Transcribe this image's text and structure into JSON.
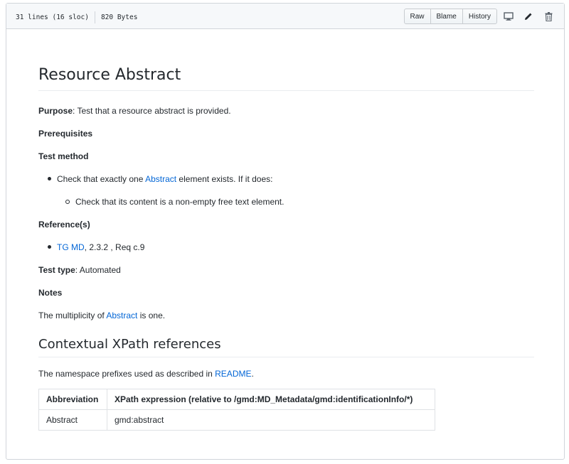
{
  "file_header": {
    "lines": "31 lines (16 sloc)",
    "size": "820 Bytes",
    "buttons": {
      "raw": "Raw",
      "blame": "Blame",
      "history": "History"
    },
    "icons": [
      "desktop-icon",
      "pencil-icon",
      "trash-icon"
    ]
  },
  "content": {
    "title": "Resource Abstract",
    "purpose_label": "Purpose",
    "purpose_text": ": Test that a resource abstract is provided.",
    "prerequisites_label": "Prerequisites",
    "test_method_label": "Test method",
    "bullet1_pre": "Check that exactly one ",
    "bullet1_link": "Abstract",
    "bullet1_post": " element exists. If it does:",
    "sub_bullet1": "Check that its content is a non-empty free text element.",
    "references_label": "Reference(s)",
    "ref_link": "TG MD",
    "ref_text": ", 2.3.2 , Req c.9",
    "test_type_label": "Test type",
    "test_type_text": ": Automated",
    "notes_label": "Notes",
    "notes_pre": "The multiplicity of ",
    "notes_link": "Abstract",
    "notes_post": " is one.",
    "subtitle": "Contextual XPath references",
    "ns_pre": "The namespace prefixes used as described in ",
    "ns_link": "README",
    "ns_post": ".",
    "table": {
      "headers": [
        "Abbreviation",
        "XPath expression (relative to /gmd:MD_Metadata/gmd:identificationInfo/*)"
      ],
      "rows": [
        [
          "Abstract",
          "gmd:abstract"
        ]
      ]
    }
  },
  "colors": {
    "link": "#0366d6",
    "text": "#24292e",
    "border": "#d1d5da"
  }
}
